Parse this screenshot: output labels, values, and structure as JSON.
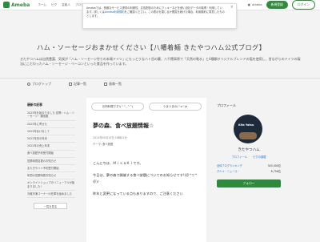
{
  "topbar": {
    "logo": "Ameba",
    "nav": [
      "ホーム",
      "ピグ",
      "芸能人",
      "ブログ"
    ],
    "app_link": "Ameba",
    "signup": "新規登録",
    "login": "ログイン"
  },
  "banner": {
    "text_a": "Amebaでは、快適なサービス提供の利便性、広告配信のためにクッキーなどを使い自社データの取得・利用しています。詳しくは",
    "link": "Ameba利用規約",
    "text_b": "をご確認ください。この表示を閉じるか閲覧を続けた場合、利用規約に同意したものとします。",
    "close": "×"
  },
  "blog": {
    "title": "ハム・ソーセージおまかせください【八幡着麺 きたやつハム公式ブログ】",
    "description": "きたやつハムは自然豊富、気候が「ハム・ソーセージ作りの本場ドイツ」にもっとりなハト岳の麓、八千穂高原で「天然の軟水」と4種類オリジナルブレンドの塩を使用し、昔ながらのドイツの製法にこだわったハム・ソーセージ・ベーコンといった食品を作っています。"
  },
  "nav": {
    "items": [
      "ブログトップ",
      "記事一覧",
      "画像一覧"
    ]
  },
  "sidebar": {
    "heading": "最新の記事",
    "items": [
      "2023年を始まりました 訪問・ハム・ソーセージ・通信販",
      "2023年に寄せた",
      "2023年あけまして",
      "2022年末の年末",
      "2022年の売上年末",
      "食べ放題予約受付開始",
      "営業時間変更のお知らせ",
      "またきやハハ予約受付開始",
      "年間の営業時間お知らせ",
      "オンラインショップのリニューアルが始まりました！",
      "冷蔵冷凍コーナーの在庫を始めました"
    ],
    "more": "一覧を見る"
  },
  "main": {
    "prev": "お肉料理です!(^^_^^)",
    "next": "うまうまの(^o^)a",
    "title": "夢の森、食べ放題情報☆",
    "date": "2024年05月15日 16時01分",
    "theme_label": "テーマ:",
    "theme": "食べ放題",
    "body": [
      "こんにちは、ＭｉｓａＫｉです。",
      "今日は、夢の森で開催する食べ放題についてのお知らせです!(＠^▽^＠)ﾉ",
      "昨年と変更になっている点もありますので、ご注意ください"
    ]
  },
  "profile": {
    "heading": "プロフィール",
    "avatar_label": "Kita Yatsu",
    "name": "きたやつハム",
    "link_profile": "プロフィール",
    "link_pig": "ピグの部屋",
    "rank1_label": "全体ブログランキング",
    "rank1_value": "343,000位",
    "rank2_label": "グルメ・ニュース・",
    "rank2_value": "8,756位",
    "follow": "フォロー"
  }
}
